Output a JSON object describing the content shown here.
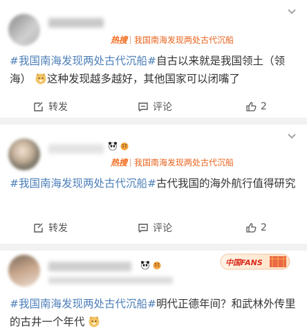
{
  "hot_label": "热搜",
  "hot_topic": "我国南海发现两处古代沉船",
  "hashtag": "#我国南海发现两处古代沉船#",
  "posts": [
    {
      "text": "自古以来就是我国领土（领海）",
      "text_after": "这种发现越多越好，其他国家可以闭嘴了",
      "repost_label": "转发",
      "comment_label": "评论",
      "like_count": "2"
    },
    {
      "text": "古代我国的海外航行值得研究",
      "repost_label": "转发",
      "comment_label": "评论",
      "like_count": "2"
    },
    {
      "text": "明代正德年间？和武林外传里的古井一个年代",
      "badge": "中国FANS"
    }
  ],
  "icons": [
    "repost-icon",
    "comment-icon",
    "like-icon",
    "more-chevron-icon",
    "doge-emoji"
  ]
}
